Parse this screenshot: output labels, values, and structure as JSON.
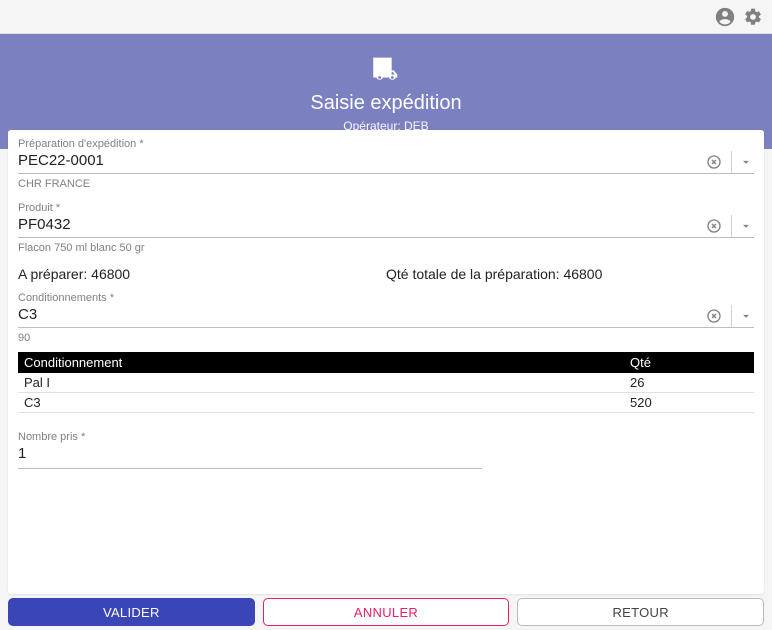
{
  "header": {
    "title": "Saisie expédition",
    "operator_label": "Opérateur:",
    "operator_value": "DEB"
  },
  "fields": {
    "prep": {
      "label": "Préparation d'expédition *",
      "value": "PEC22-0001",
      "hint": "CHR FRANCE"
    },
    "product": {
      "label": "Produit *",
      "value": "PF0432",
      "hint": "Flacon 750 ml blanc 50 gr"
    },
    "packaging": {
      "label": "Conditionnements *",
      "value": "C3",
      "hint": "90"
    },
    "qty_taken": {
      "label": "Nombre pris *",
      "value": "1"
    }
  },
  "info": {
    "to_prepare_label": "A préparer:",
    "to_prepare_value": "46800",
    "total_label": "Qté totale de la préparation:",
    "total_value": "46800"
  },
  "table": {
    "col_pack": "Conditionnement",
    "col_qty": "Qté",
    "rows": [
      {
        "pack": "Pal I",
        "qty": "26"
      },
      {
        "pack": "C3",
        "qty": "520"
      }
    ]
  },
  "buttons": {
    "validate": "VALIDER",
    "cancel": "ANNULER",
    "back": "RETOUR"
  }
}
